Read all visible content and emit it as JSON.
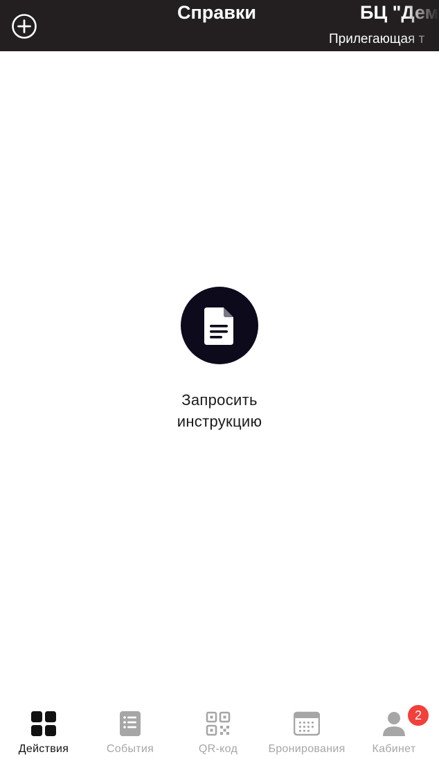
{
  "header": {
    "title": "Справки",
    "building_name": "БЦ \"Дем",
    "building_subtitle": "Прилегающая т",
    "background_color": "#231f20"
  },
  "main": {
    "action": {
      "icon": "document-icon",
      "label_line1": "Запросить",
      "label_line2": "инструкцию"
    }
  },
  "bottom_nav": {
    "active_color": "#111111",
    "inactive_color": "#a6a6a6",
    "items": [
      {
        "label": "Действия",
        "icon": "grid-icon",
        "active": true
      },
      {
        "label": "События",
        "icon": "list-icon",
        "active": false
      },
      {
        "label": "QR-код",
        "icon": "qr-code-icon",
        "active": false
      },
      {
        "label": "Бронирования",
        "icon": "calendar-icon",
        "active": false
      },
      {
        "label": "Кабинет",
        "icon": "user-icon",
        "active": false,
        "badge": "2"
      }
    ]
  }
}
